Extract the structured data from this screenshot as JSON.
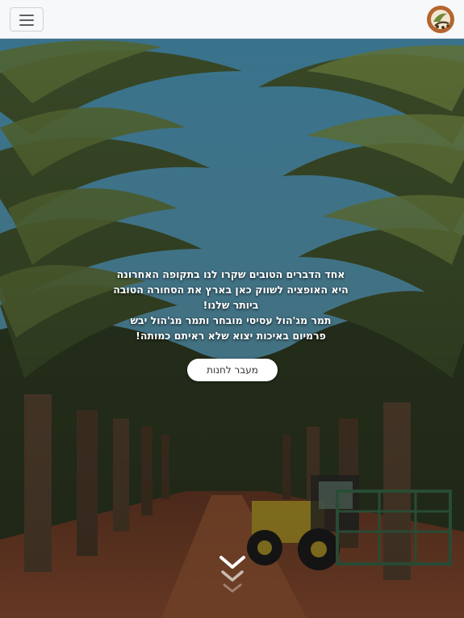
{
  "navbar": {
    "menu_icon": "hamburger-icon",
    "logo_icon": "date-palm-logo-icon"
  },
  "hero": {
    "paragraph_1": "אחד הדברים הטובים שקרו לנו בתקופה האחרונה היא האופציה לשווק כאן בארץ את הסחורה הטובה ביותר שלנו!",
    "paragraph_2": "תמר מג'הול עסיסי מובחר ותמר מג'הול יבש פרמיום באיכות יצוא שלא ראיתם כמותה!",
    "cta_label": "מעבר לחנות",
    "scroll_icon": "chevron-down-icon"
  },
  "colors": {
    "navbar_bg": "#f7f8fa",
    "logo_brown": "#a0522d",
    "sky": "#4b8aa4",
    "soil": "#8a4a2e"
  }
}
